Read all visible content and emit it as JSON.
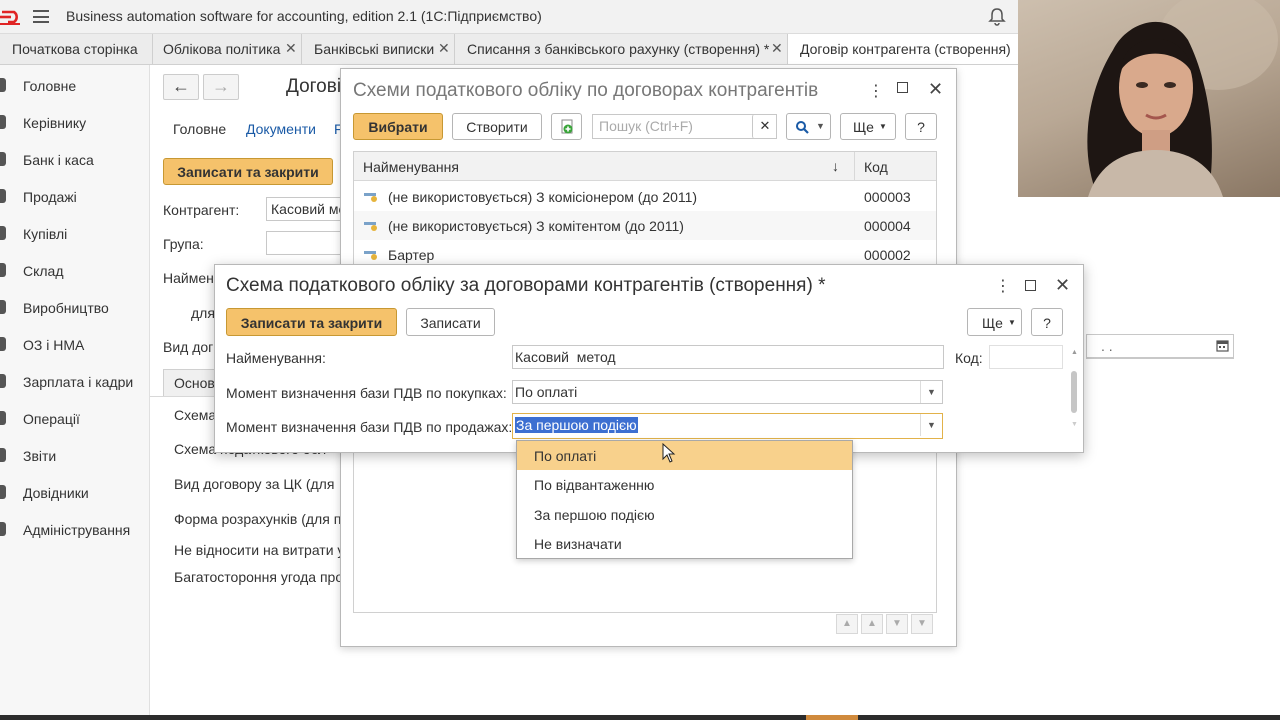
{
  "app": {
    "title": "Business automation software for accounting, edition 2.1  (1С:Підприємство)"
  },
  "tabs": [
    {
      "label": "Початкова сторінка"
    },
    {
      "label": "Облікова політика"
    },
    {
      "label": "Банківські виписки"
    },
    {
      "label": "Списання з банківського рахунку (створення) *"
    },
    {
      "label": "Договір контрагента (створення)"
    }
  ],
  "sidebar": {
    "items": [
      {
        "label": "Головне"
      },
      {
        "label": "Керівнику"
      },
      {
        "label": "Банк і каса"
      },
      {
        "label": "Продажі"
      },
      {
        "label": "Купівлі"
      },
      {
        "label": "Склад"
      },
      {
        "label": "Виробництво"
      },
      {
        "label": "ОЗ і НМА"
      },
      {
        "label": "Зарплата і кадри"
      },
      {
        "label": "Операції"
      },
      {
        "label": "Звіти"
      },
      {
        "label": "Довідники"
      },
      {
        "label": "Адміністрування"
      }
    ]
  },
  "bg_form": {
    "title": "Догові",
    "tab_main": "Головне",
    "tab_docs": "Документи",
    "tab_more": "F",
    "save_close": "Записати та закрити",
    "kontragent_label": "Контрагент:",
    "kontragent_value": "Касовий ме",
    "group_label": "Група:",
    "name_label": "Наймен",
    "for_label": "для",
    "vid_label": "Вид дог",
    "tab_basic": "Основ",
    "rows": [
      "Схема",
      "Схема податкового обл",
      "Вид договору за ЦК (для",
      "Форма розрахунків (для п",
      "Не відносити на витрати у",
      "Багатостороння угода про"
    ],
    "date_value": ". ."
  },
  "dialog_list": {
    "title": "Схеми податкового обліку по договорах контрагентів",
    "select_label": "Вибрати",
    "create_label": "Створити",
    "search_placeholder": "Пошук (Ctrl+F)",
    "more_label": "Ще",
    "help_label": "?",
    "col_name": "Найменування",
    "col_code": "Код",
    "sort_arrow": "↓",
    "rows": [
      {
        "name": "(не використовується) З комісіонером (до 2011)",
        "code": "000003"
      },
      {
        "name": "(не використовується) З комітентом (до 2011)",
        "code": "000004"
      },
      {
        "name": "Бартер",
        "code": "000002"
      }
    ]
  },
  "dialog_edit": {
    "title": "Схема податкового обліку за договорами контрагентів (створення) *",
    "save_close": "Записати та закрити",
    "save": "Записати",
    "more_label": "Ще",
    "help_label": "?",
    "name_label": "Найменування:",
    "name_value": "Касовий  метод",
    "code_label": "Код:",
    "purchase_label": "Момент визначення бази ПДВ по покупках:",
    "purchase_value": "По оплаті",
    "sales_label": "Момент визначення бази ПДВ по продажах:",
    "sales_value": "За першою подією"
  },
  "dropdown": {
    "options": [
      {
        "label": "По оплаті"
      },
      {
        "label": "По відвантаженню"
      },
      {
        "label": "За першою подією"
      },
      {
        "label": "Не визначати"
      }
    ]
  },
  "colors": {
    "accent_yellow": "#f5c26b",
    "highlight": "#f8d18c",
    "selection": "#3d6fd1",
    "link": "#1a5aa6"
  },
  "icons": [
    "logo-icon",
    "hamburger-icon",
    "bell-icon",
    "close-icon",
    "more-icon",
    "maximize-icon",
    "search-icon",
    "add-copy-icon",
    "calendar-icon",
    "scheme-row-icon",
    "cursor-icon"
  ]
}
